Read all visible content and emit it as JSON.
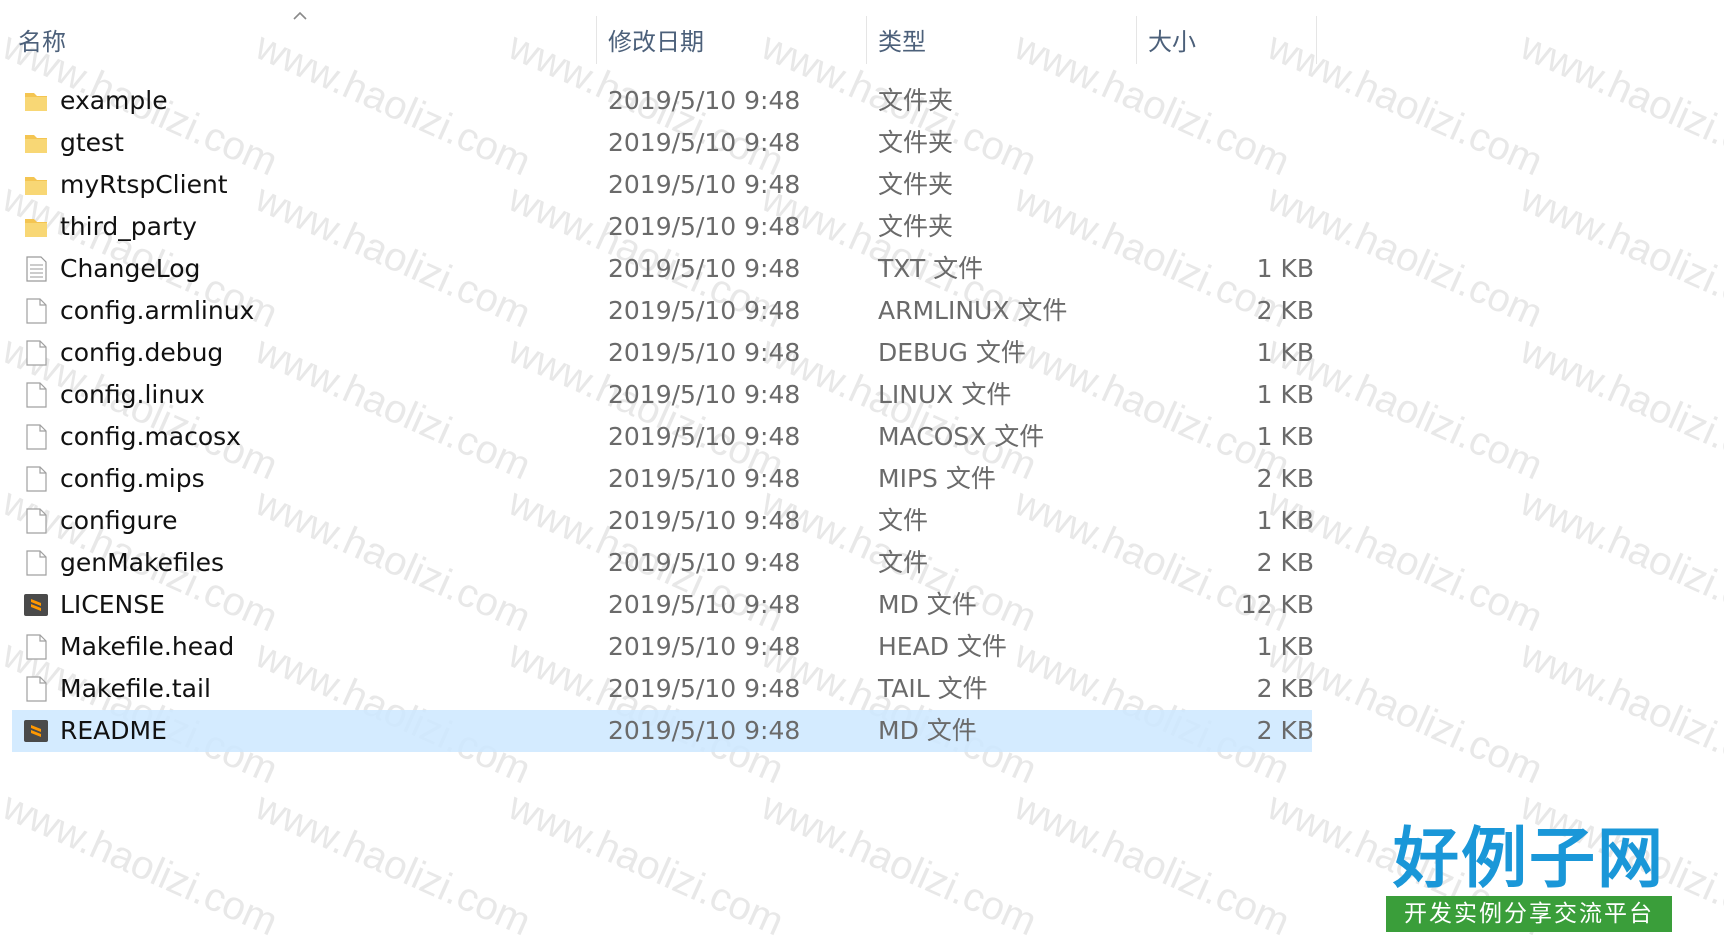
{
  "columns": {
    "name": "名称",
    "date": "修改日期",
    "type": "类型",
    "size": "大小"
  },
  "files": [
    {
      "name": "example",
      "date": "2019/5/10 9:48",
      "type": "文件夹",
      "size": "",
      "icon": "folder-icon"
    },
    {
      "name": "gtest",
      "date": "2019/5/10 9:48",
      "type": "文件夹",
      "size": "",
      "icon": "folder-icon"
    },
    {
      "name": "myRtspClient",
      "date": "2019/5/10 9:48",
      "type": "文件夹",
      "size": "",
      "icon": "folder-icon"
    },
    {
      "name": "third_party",
      "date": "2019/5/10 9:48",
      "type": "文件夹",
      "size": "",
      "icon": "folder-icon"
    },
    {
      "name": "ChangeLog",
      "date": "2019/5/10 9:48",
      "type": "TXT 文件",
      "size": "1 KB",
      "icon": "text-file-icon"
    },
    {
      "name": "config.armlinux",
      "date": "2019/5/10 9:48",
      "type": "ARMLINUX 文件",
      "size": "2 KB",
      "icon": "file-icon"
    },
    {
      "name": "config.debug",
      "date": "2019/5/10 9:48",
      "type": "DEBUG 文件",
      "size": "1 KB",
      "icon": "file-icon"
    },
    {
      "name": "config.linux",
      "date": "2019/5/10 9:48",
      "type": "LINUX 文件",
      "size": "1 KB",
      "icon": "file-icon"
    },
    {
      "name": "config.macosx",
      "date": "2019/5/10 9:48",
      "type": "MACOSX 文件",
      "size": "1 KB",
      "icon": "file-icon"
    },
    {
      "name": "config.mips",
      "date": "2019/5/10 9:48",
      "type": "MIPS 文件",
      "size": "2 KB",
      "icon": "file-icon"
    },
    {
      "name": "configure",
      "date": "2019/5/10 9:48",
      "type": "文件",
      "size": "1 KB",
      "icon": "file-icon"
    },
    {
      "name": "genMakefiles",
      "date": "2019/5/10 9:48",
      "type": "文件",
      "size": "2 KB",
      "icon": "file-icon"
    },
    {
      "name": "LICENSE",
      "date": "2019/5/10 9:48",
      "type": "MD 文件",
      "size": "12 KB",
      "icon": "sublime-file-icon"
    },
    {
      "name": "Makefile.head",
      "date": "2019/5/10 9:48",
      "type": "HEAD 文件",
      "size": "1 KB",
      "icon": "file-icon"
    },
    {
      "name": "Makefile.tail",
      "date": "2019/5/10 9:48",
      "type": "TAIL 文件",
      "size": "2 KB",
      "icon": "file-icon"
    },
    {
      "name": "README",
      "date": "2019/5/10 9:48",
      "type": "MD 文件",
      "size": "2 KB",
      "icon": "sublime-file-icon",
      "selected": true
    }
  ],
  "watermark": "www.haolizi.com",
  "logo": {
    "main": "好例子网",
    "sub": "开发实例分享交流平台"
  },
  "colors": {
    "folder": "#f4c552",
    "selection": "#cce8ff",
    "header_text": "#4c607a",
    "logo_blue": "#1a97d8",
    "logo_green": "#3a9e3a"
  }
}
